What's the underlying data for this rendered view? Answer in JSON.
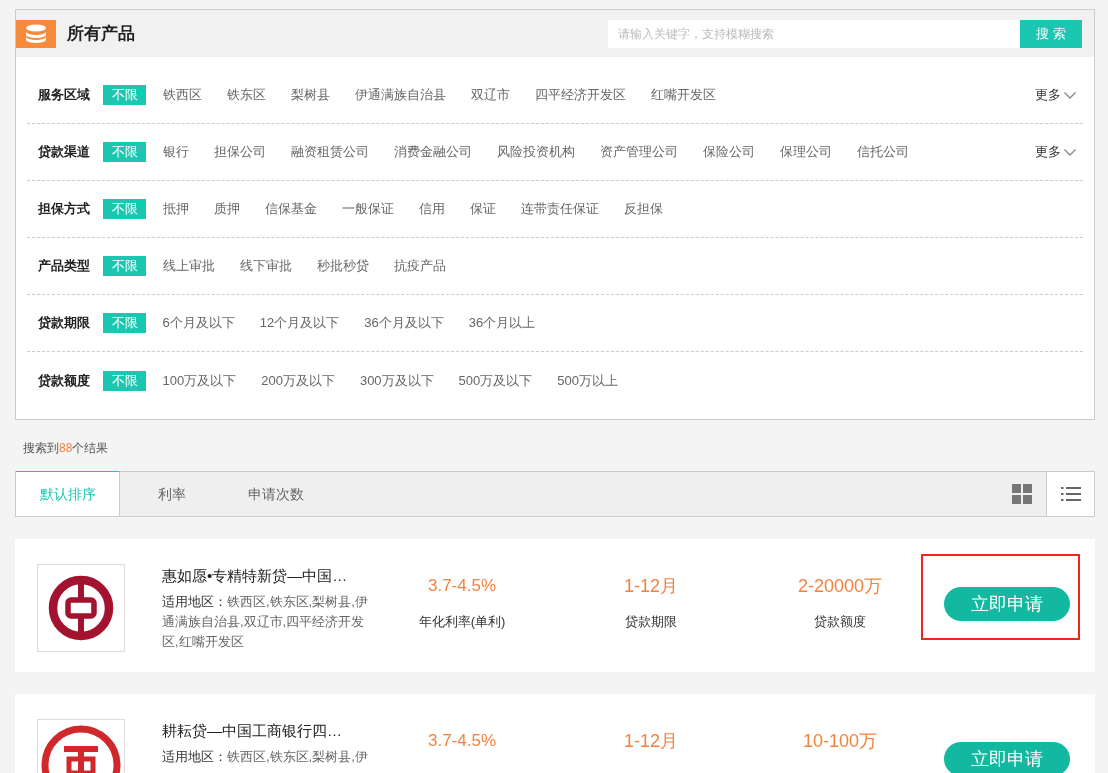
{
  "header": {
    "title": "所有产品",
    "search": {
      "placeholder": "请输入关键字，支持模糊搜索",
      "button": "搜 索"
    }
  },
  "filters": [
    {
      "label": "服务区域",
      "options": [
        {
          "label": "不限",
          "selected": true
        },
        {
          "label": "铁西区",
          "selected": false
        },
        {
          "label": "铁东区",
          "selected": false
        },
        {
          "label": "梨树县",
          "selected": false
        },
        {
          "label": "伊通满族自治县",
          "selected": false
        },
        {
          "label": "双辽市",
          "selected": false
        },
        {
          "label": "四平经济开发区",
          "selected": false
        },
        {
          "label": "红嘴开发区",
          "selected": false
        }
      ],
      "more": "更多"
    },
    {
      "label": "贷款渠道",
      "options": [
        {
          "label": "不限",
          "selected": true
        },
        {
          "label": "银行",
          "selected": false
        },
        {
          "label": "担保公司",
          "selected": false
        },
        {
          "label": "融资租赁公司",
          "selected": false
        },
        {
          "label": "消费金融公司",
          "selected": false
        },
        {
          "label": "风险投资机构",
          "selected": false
        },
        {
          "label": "资产管理公司",
          "selected": false
        },
        {
          "label": "保险公司",
          "selected": false
        },
        {
          "label": "保理公司",
          "selected": false
        },
        {
          "label": "信托公司",
          "selected": false
        }
      ],
      "more": "更多"
    },
    {
      "label": "担保方式",
      "options": [
        {
          "label": "不限",
          "selected": true
        },
        {
          "label": "抵押",
          "selected": false
        },
        {
          "label": "质押",
          "selected": false
        },
        {
          "label": "信保基金",
          "selected": false
        },
        {
          "label": "一般保证",
          "selected": false
        },
        {
          "label": "信用",
          "selected": false
        },
        {
          "label": "保证",
          "selected": false
        },
        {
          "label": "连带责任保证",
          "selected": false
        },
        {
          "label": "反担保",
          "selected": false
        }
      ]
    },
    {
      "label": "产品类型",
      "options": [
        {
          "label": "不限",
          "selected": true
        },
        {
          "label": "线上审批",
          "selected": false
        },
        {
          "label": "线下审批",
          "selected": false
        },
        {
          "label": "秒批秒贷",
          "selected": false
        },
        {
          "label": "抗疫产品",
          "selected": false
        }
      ]
    },
    {
      "label": "贷款期限",
      "options": [
        {
          "label": "不限",
          "selected": true
        },
        {
          "label": "6个月及以下",
          "selected": false
        },
        {
          "label": "12个月及以下",
          "selected": false
        },
        {
          "label": "36个月及以下",
          "selected": false
        },
        {
          "label": "36个月以上",
          "selected": false
        }
      ]
    },
    {
      "label": "贷款额度",
      "options": [
        {
          "label": "不限",
          "selected": true
        },
        {
          "label": "100万及以下",
          "selected": false
        },
        {
          "label": "200万及以下",
          "selected": false
        },
        {
          "label": "300万及以下",
          "selected": false
        },
        {
          "label": "500万及以下",
          "selected": false
        },
        {
          "label": "500万以上",
          "selected": false
        }
      ]
    }
  ],
  "results": {
    "before": "搜索到",
    "count": "88",
    "after": "个结果"
  },
  "sort_tabs": [
    {
      "label": "默认排序",
      "selected": true
    },
    {
      "label": "利率",
      "selected": false
    },
    {
      "label": "申请次数",
      "selected": false
    }
  ],
  "view_toggles": [
    {
      "kind": "grid",
      "selected": false
    },
    {
      "kind": "list",
      "selected": true
    }
  ],
  "products": [
    {
      "kind": "boc",
      "title": "惠如愿•专精特新贷—中国…",
      "region_label": "适用地区：",
      "regions": "铁西区,铁东区,梨树县,伊通满族自治县,双辽市,四平经济开发区,红嘴开发区",
      "rate": "3.7-4.5%",
      "rate_caption": "年化利率(单利)",
      "term": "1-12月",
      "term_caption": "贷款期限",
      "amount": "2-20000万",
      "amount_caption": "贷款额度",
      "button": "立即申请",
      "highlighted": true
    },
    {
      "kind": "icbc",
      "title": "耕耘贷—中国工商银行四…",
      "region_label": "适用地区：",
      "regions": "铁西区,铁东区,梨树县,伊",
      "rate": "3.7-4.5%",
      "term": "1-12月",
      "amount": "10-100万",
      "button": "立即申请",
      "highlighted": false
    }
  ]
}
